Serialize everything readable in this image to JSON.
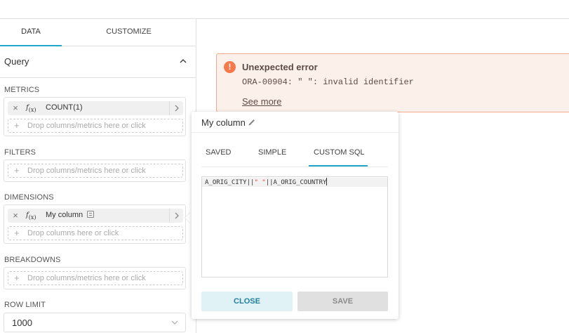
{
  "tabs": {
    "data": "DATA",
    "customize": "CUSTOMIZE"
  },
  "query": {
    "title": "Query"
  },
  "metrics": {
    "label": "METRICS",
    "item_prefix": "f(x)",
    "item_label": "COUNT(1)",
    "drop_placeholder": "Drop columns/metrics here or click"
  },
  "filters": {
    "label": "FILTERS",
    "drop_placeholder": "Drop columns/metrics here or click"
  },
  "dimensions": {
    "label": "DIMENSIONS",
    "item_prefix": "f(x)",
    "item_label": "My column",
    "drop_placeholder": "Drop columns here or click"
  },
  "breakdowns": {
    "label": "BREAKDOWNS",
    "drop_placeholder": "Drop columns/metrics here or click"
  },
  "row_limit": {
    "label": "ROW LIMIT",
    "value": "1000"
  },
  "error": {
    "title": "Unexpected error",
    "message": "ORA-00904: \" \": invalid identifier",
    "link": "See more",
    "accent": "#f5794a"
  },
  "popover": {
    "title": "My column",
    "tabs": {
      "saved": "SAVED",
      "simple": "SIMPLE",
      "custom_sql": "CUSTOM SQL"
    },
    "sql": {
      "part1": "A_ORIG_CITY||",
      "str": "\" \"",
      "part2": "||A_ORIG_COUNTRY"
    },
    "close_label": "CLOSE",
    "save_label": "SAVE"
  },
  "colors": {
    "accent": "#20a7c9"
  }
}
